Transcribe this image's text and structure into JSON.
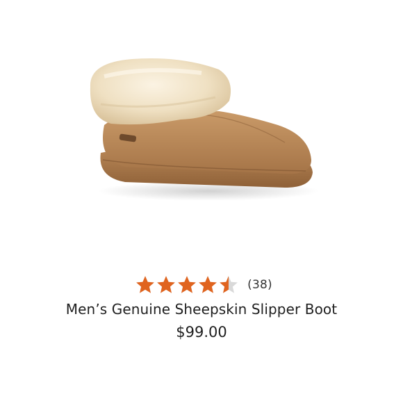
{
  "product": {
    "image_alt": "shearling-cuffed suede slipper boot",
    "rating": 4.5,
    "rating_max": 5,
    "review_count_label": "(38)",
    "title": "Men’s Genuine Sheepskin Slipper Boot",
    "price": "$99.00"
  },
  "colors": {
    "star": "#e0641f",
    "star_empty": "#d9d9d9",
    "text": "#1e1e1e"
  },
  "icons": {
    "star": "star-icon"
  }
}
